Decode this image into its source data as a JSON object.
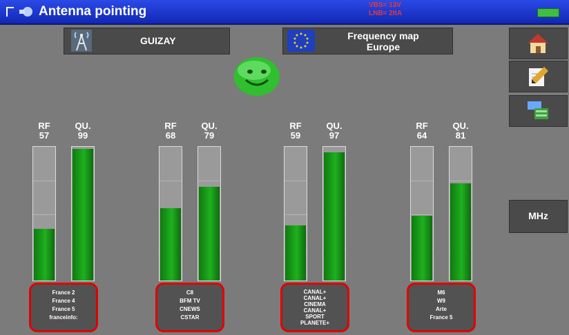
{
  "window": {
    "title": "Antenna pointing"
  },
  "status": {
    "line1": "VBS= 13V",
    "line2": "LNB= 2ItA"
  },
  "header": {
    "antenna_label": "GUIZAY",
    "freq_line1": "Frequency map",
    "freq_line2": "Europe"
  },
  "side": {
    "mhz_label": "MHz"
  },
  "icons": {
    "home": "home-icon",
    "edit": "edit-icon",
    "display": "display-mode-icon",
    "antenna": "antenna-icon",
    "europe": "eu-flag-icon",
    "smiley": "smiley-icon"
  },
  "colors": {
    "titlebar": "#1f3bd6",
    "bar_fill": "#1fa51f",
    "highlight": "#e10000",
    "smiley": "#3ed23e"
  },
  "channels": [
    {
      "rf_label": "RF",
      "rf_value": "57",
      "qu_label": "QU.",
      "qu_value": "99",
      "rf_level": 57,
      "qu_level": 99,
      "programs": [
        "France 2",
        "France 4",
        "France 5",
        "franceinfo:"
      ]
    },
    {
      "rf_label": "RF",
      "rf_value": "68",
      "qu_label": "QU.",
      "qu_value": "79",
      "rf_level": 68,
      "qu_level": 79,
      "programs": [
        "C8",
        "BFM TV",
        "CNEWS",
        "CSTAR"
      ]
    },
    {
      "rf_label": "RF",
      "rf_value": "59",
      "qu_label": "QU.",
      "qu_value": "97",
      "rf_level": 59,
      "qu_level": 97,
      "programs": [
        "CANAL+",
        "CANAL+",
        "CINEMA",
        "CANAL+",
        "SPORT",
        "PLANETE+"
      ]
    },
    {
      "rf_label": "RF",
      "rf_value": "64",
      "qu_label": "QU.",
      "qu_value": "81",
      "rf_level": 64,
      "qu_level": 81,
      "programs": [
        "M6",
        "W9",
        "Arte",
        "France 5"
      ]
    }
  ]
}
